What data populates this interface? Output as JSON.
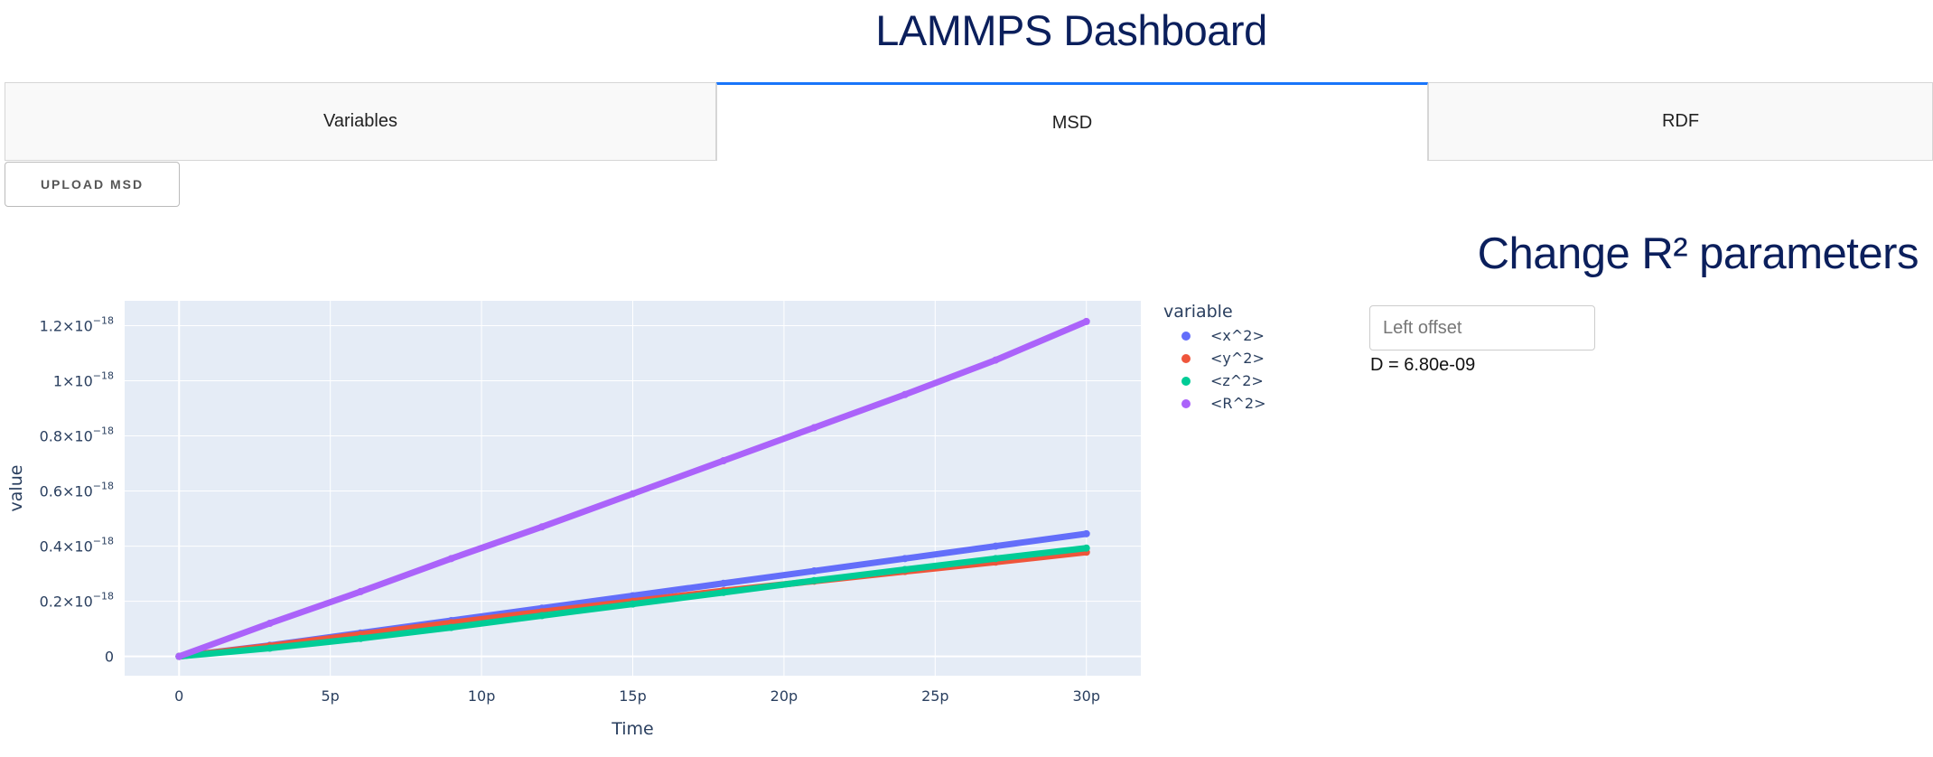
{
  "app": {
    "title": "LAMMPS Dashboard"
  },
  "tabs": [
    {
      "label": "Variables",
      "active": false
    },
    {
      "label": "MSD",
      "active": true
    },
    {
      "label": "RDF",
      "active": false
    }
  ],
  "upload": {
    "label": "UPLOAD MSD"
  },
  "r2_panel": {
    "heading": "Change R² parameters",
    "left_offset_placeholder": "Left offset",
    "left_offset_value": "",
    "d_value": "D = 6.80e-09"
  },
  "colors": {
    "accent": "#1975fa",
    "title": "#0b1f5c",
    "plot_bg": "#e5ecf6"
  },
  "chart_data": {
    "type": "scatter",
    "xlabel": "Time",
    "ylabel": "value",
    "legend_title": "variable",
    "legend_position": "right",
    "grid": true,
    "xlim": [
      -1.8e-12,
      3.18e-11
    ],
    "ylim": [
      -7e-20,
      1.29e-18
    ],
    "xticks": [
      {
        "value": 0,
        "label": "0"
      },
      {
        "value": 5e-12,
        "label": "5p"
      },
      {
        "value": 1e-11,
        "label": "10p"
      },
      {
        "value": 1.5e-11,
        "label": "15p"
      },
      {
        "value": 2e-11,
        "label": "20p"
      },
      {
        "value": 2.5e-11,
        "label": "25p"
      },
      {
        "value": 3e-11,
        "label": "30p"
      }
    ],
    "yticks": [
      {
        "value": 0,
        "mantissa": "0",
        "exp": ""
      },
      {
        "value": 2e-19,
        "mantissa": "0.2×10",
        "exp": "−18"
      },
      {
        "value": 4e-19,
        "mantissa": "0.4×10",
        "exp": "−18"
      },
      {
        "value": 6e-19,
        "mantissa": "0.6×10",
        "exp": "−18"
      },
      {
        "value": 8e-19,
        "mantissa": "0.8×10",
        "exp": "−18"
      },
      {
        "value": 1e-18,
        "mantissa": "1×10",
        "exp": "−18"
      },
      {
        "value": 1.2e-18,
        "mantissa": "1.2×10",
        "exp": "−18"
      }
    ],
    "x": [
      0,
      3e-12,
      6e-12,
      9e-12,
      1.2e-11,
      1.5e-11,
      1.8e-11,
      2.1e-11,
      2.4e-11,
      2.7e-11,
      3e-11
    ],
    "series": [
      {
        "name": "<x^2>",
        "color": "#636efa",
        "values": [
          0,
          4e-20,
          8.5e-20,
          1.3e-19,
          1.75e-19,
          2.2e-19,
          2.65e-19,
          3.1e-19,
          3.55e-19,
          4e-19,
          4.45e-19
        ]
      },
      {
        "name": "<y^2>",
        "color": "#ef553b",
        "values": [
          0,
          3.8e-20,
          8e-20,
          1.22e-19,
          1.62e-19,
          2e-19,
          2.38e-19,
          2.73e-19,
          3.08e-19,
          3.42e-19,
          3.78e-19
        ]
      },
      {
        "name": "<z^2>",
        "color": "#00cc96",
        "values": [
          0,
          3e-20,
          6.5e-20,
          1.05e-19,
          1.48e-19,
          1.9e-19,
          2.32e-19,
          2.75e-19,
          3.15e-19,
          3.55e-19,
          3.93e-19
        ]
      },
      {
        "name": "<R^2>",
        "color": "#ab63fa",
        "values": [
          0,
          1.2e-19,
          2.35e-19,
          3.55e-19,
          4.7e-19,
          5.9e-19,
          7.1e-19,
          8.3e-19,
          9.5e-19,
          1.075e-18,
          1.215e-18
        ]
      }
    ]
  }
}
